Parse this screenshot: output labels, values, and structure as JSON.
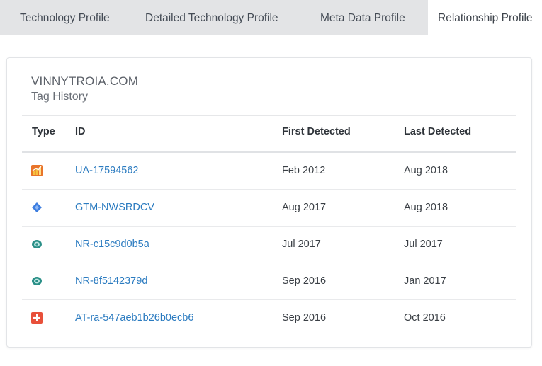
{
  "tabs": [
    {
      "label": "Technology Profile",
      "active": false
    },
    {
      "label": "Detailed Technology Profile",
      "active": false
    },
    {
      "label": "Meta Data Profile",
      "active": false
    },
    {
      "label": "Relationship Profile",
      "active": true
    }
  ],
  "panel": {
    "domain": "VINNYTROIA.COM",
    "subtitle": "Tag History"
  },
  "table": {
    "columns": [
      "Type",
      "ID",
      "First Detected",
      "Last Detected"
    ],
    "rows": [
      {
        "icon": "google-analytics-icon",
        "id": "UA-17594562",
        "first": "Feb 2012",
        "last": "Aug 2018"
      },
      {
        "icon": "google-tag-manager-icon",
        "id": "GTM-NWSRDCV",
        "first": "Aug 2017",
        "last": "Aug 2018"
      },
      {
        "icon": "new-relic-icon",
        "id": "NR-c15c9d0b5a",
        "first": "Jul 2017",
        "last": "Jul 2017"
      },
      {
        "icon": "new-relic-icon",
        "id": "NR-8f5142379d",
        "first": "Sep 2016",
        "last": "Jan 2017"
      },
      {
        "icon": "addthis-icon",
        "id": "AT-ra-547aeb1b26b0ecb6",
        "first": "Sep 2016",
        "last": "Oct 2016"
      }
    ]
  },
  "colors": {
    "link": "#2b7bc0",
    "tabbar": "#e3e4e6",
    "analytics": "#e8742a",
    "tagmanager": "#3d7ee0",
    "newrelic": "#2a8f87",
    "addthis": "#e8503a"
  }
}
